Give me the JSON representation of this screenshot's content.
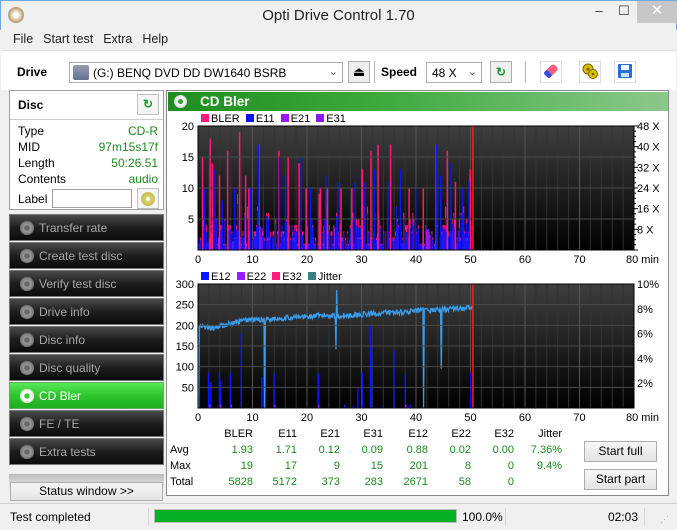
{
  "window": {
    "title": "Opti Drive Control 1.70",
    "minimize": "–",
    "maximize": "☐",
    "close": "✕"
  },
  "menu": [
    "File",
    "Start test",
    "Extra",
    "Help"
  ],
  "toolbar": {
    "drive_label": "Drive",
    "drive_value": "(G:)   BENQ DVD DD DW1640 BSRB",
    "speed_label": "Speed",
    "speed_value": "48 X",
    "eject_icon": "⏏",
    "refresh_icon": "↻"
  },
  "disc": {
    "title": "Disc",
    "fields": [
      {
        "key": "Type",
        "value": "CD-R"
      },
      {
        "key": "MID",
        "value": "97m15s17f"
      },
      {
        "key": "Length",
        "value": "50:26.51"
      },
      {
        "key": "Contents",
        "value": "audio"
      }
    ],
    "label_key": "Label",
    "label_value": ""
  },
  "nav": [
    {
      "label": "Transfer rate",
      "active": false
    },
    {
      "label": "Create test disc",
      "active": false
    },
    {
      "label": "Verify test disc",
      "active": false
    },
    {
      "label": "Drive info",
      "active": false
    },
    {
      "label": "Disc info",
      "active": false
    },
    {
      "label": "Disc quality",
      "active": false
    },
    {
      "label": "CD Bler",
      "active": true
    },
    {
      "label": "FE / TE",
      "active": false
    },
    {
      "label": "Extra tests",
      "active": false
    }
  ],
  "status_window_button": "Status window >>",
  "panel": {
    "title": "CD Bler"
  },
  "colors": {
    "bler": "#ff1a7a",
    "e11": "#0a14ff",
    "e21": "#9a1aff",
    "e31": "#8a1aee",
    "e12": "#0a14ff",
    "e22": "#9a1aff",
    "e32": "#ff1a7a",
    "jitter": "#3a9ef0",
    "jitter_legend": "#3a8080",
    "end_marker": "#ff1a1a",
    "accent": "#2ec52e"
  },
  "chart_data": [
    {
      "type": "bar",
      "title": "CD Bler - BLER/E11/E21/E31",
      "legend": [
        "BLER",
        "E11",
        "E21",
        "E31"
      ],
      "legend_position": "top-left",
      "xlabel": "min",
      "x_ticks": [
        "0",
        "10",
        "20",
        "30",
        "40",
        "50",
        "60",
        "70",
        "80 min"
      ],
      "xlim": [
        0,
        80
      ],
      "y_ticks": [
        "5",
        "10",
        "15",
        "20"
      ],
      "ylim": [
        0,
        20
      ],
      "y2_ticks": [
        "8 X",
        "16 X",
        "24 X",
        "32 X",
        "40 X",
        "48 X"
      ],
      "y2lim": [
        0,
        48
      ],
      "end_marker_min": 50.44,
      "series_bler_peaks": [
        [
          0.7,
          15
        ],
        [
          2.1,
          18
        ],
        [
          2.5,
          14
        ],
        [
          3.8,
          12
        ],
        [
          5.3,
          16
        ],
        [
          7.5,
          19
        ],
        [
          8.6,
          12
        ],
        [
          9.2,
          10
        ],
        [
          11.1,
          17
        ],
        [
          14.7,
          16
        ],
        [
          16.4,
          15
        ],
        [
          18.4,
          14
        ],
        [
          19.7,
          10
        ],
        [
          22.1,
          9
        ],
        [
          22.3,
          10
        ],
        [
          23.6,
          10
        ],
        [
          26.1,
          10
        ],
        [
          28.1,
          10
        ],
        [
          30.0,
          13
        ],
        [
          31.6,
          16
        ],
        [
          32.9,
          17
        ],
        [
          35.2,
          17
        ],
        [
          38.6,
          10
        ],
        [
          41.2,
          10
        ],
        [
          43.5,
          17
        ],
        [
          45.6,
          16
        ],
        [
          47.1,
          11
        ],
        [
          49.8,
          13
        ]
      ],
      "series_e11_peaks": [
        [
          1.1,
          10
        ],
        [
          3.0,
          13
        ],
        [
          4.3,
          8
        ],
        [
          6.6,
          10
        ],
        [
          9.5,
          10
        ],
        [
          11.0,
          17
        ],
        [
          14.8,
          15
        ],
        [
          15.9,
          12
        ],
        [
          18.8,
          15
        ],
        [
          20.5,
          10
        ],
        [
          23.3,
          12
        ],
        [
          25.5,
          11
        ],
        [
          28.7,
          11
        ],
        [
          30.5,
          11
        ],
        [
          32.2,
          13
        ],
        [
          34.7,
          11
        ],
        [
          37.0,
          13
        ],
        [
          39.8,
          10
        ],
        [
          43.6,
          17
        ],
        [
          44.4,
          12
        ],
        [
          46.3,
          14
        ],
        [
          48.4,
          10
        ],
        [
          49.6,
          11
        ]
      ],
      "baseline_avg": 1.93,
      "bar_density_per_min": 6
    },
    {
      "type": "bar",
      "title": "CD Bler - E12/E22/E32/Jitter",
      "legend": [
        "E12",
        "E22",
        "E32",
        "Jitter"
      ],
      "legend_position": "top-left",
      "xlabel": "min",
      "x_ticks": [
        "0",
        "10",
        "20",
        "30",
        "40",
        "50",
        "60",
        "70",
        "80 min"
      ],
      "xlim": [
        0,
        80
      ],
      "y_ticks": [
        "50",
        "100",
        "150",
        "200",
        "250",
        "300"
      ],
      "ylim": [
        0,
        300
      ],
      "y2_ticks": [
        "2%",
        "4%",
        "6%",
        "8%",
        "10%"
      ],
      "y2lim": [
        0,
        10
      ],
      "end_marker_min": 50.44,
      "e12_bars": [
        [
          1.8,
          85
        ],
        [
          2.2,
          62
        ],
        [
          3.8,
          85
        ],
        [
          4.0,
          65
        ],
        [
          5.8,
          85
        ],
        [
          7.8,
          183
        ],
        [
          11.6,
          75
        ],
        [
          13.8,
          85
        ],
        [
          22.0,
          83
        ],
        [
          26.8,
          8
        ],
        [
          28.3,
          5
        ],
        [
          29.2,
          48
        ],
        [
          30.0,
          85
        ],
        [
          31.5,
          200
        ],
        [
          31.7,
          148
        ],
        [
          33.8,
          5
        ],
        [
          35.8,
          140
        ],
        [
          37.9,
          85
        ],
        [
          38.8,
          8
        ],
        [
          49.9,
          85
        ]
      ],
      "jitter_dips": [
        [
          0.1,
          0
        ],
        [
          12.2,
          0
        ],
        [
          25.3,
          142
        ],
        [
          25.4,
          285
        ],
        [
          41.4,
          0
        ],
        [
          44.6,
          95
        ]
      ],
      "jitter_avg_pct": 7.36,
      "jitter_max_pct": 9.4
    }
  ],
  "stats": {
    "columns": [
      "BLER",
      "E11",
      "E21",
      "E31",
      "E12",
      "E22",
      "E32",
      "Jitter"
    ],
    "rows": [
      {
        "label": "Avg",
        "values": [
          "1.93",
          "1.71",
          "0.12",
          "0.09",
          "0.88",
          "0.02",
          "0.00",
          "7.36%"
        ]
      },
      {
        "label": "Max",
        "values": [
          "19",
          "17",
          "9",
          "15",
          "201",
          "8",
          "0",
          "9.4%"
        ]
      },
      {
        "label": "Total",
        "values": [
          "5828",
          "5172",
          "373",
          "283",
          "2671",
          "58",
          "0",
          ""
        ]
      }
    ]
  },
  "buttons": {
    "start_full": "Start full",
    "start_part": "Start part"
  },
  "status": {
    "text": "Test completed",
    "progress_pct": 100.0,
    "progress_label": "100.0%",
    "elapsed": "02:03"
  }
}
